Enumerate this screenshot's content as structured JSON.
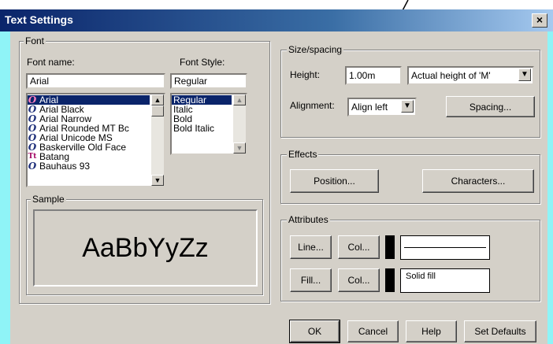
{
  "window": {
    "title": "Text Settings",
    "close_glyph": "×"
  },
  "font": {
    "legend": "Font",
    "name_label": "Font name:",
    "style_label": "Font Style:",
    "name_value": "Arial",
    "style_value": "Regular",
    "fonts": [
      {
        "label": "Arial",
        "icon": "O",
        "selected": true
      },
      {
        "label": "Arial Black",
        "icon": "O"
      },
      {
        "label": "Arial Narrow",
        "icon": "O"
      },
      {
        "label": "Arial Rounded MT Bc",
        "icon": "O"
      },
      {
        "label": "Arial Unicode MS",
        "icon": "O"
      },
      {
        "label": "Baskerville Old Face",
        "icon": "O"
      },
      {
        "label": "Batang",
        "icon": "Tt"
      },
      {
        "label": "Bauhaus 93",
        "icon": "O"
      }
    ],
    "styles": [
      {
        "label": "Regular",
        "selected": true
      },
      {
        "label": "Italic"
      },
      {
        "label": "Bold"
      },
      {
        "label": "Bold Italic"
      }
    ]
  },
  "sample": {
    "legend": "Sample",
    "text": "AaBbYyZz"
  },
  "size": {
    "legend": "Size/spacing",
    "height_label": "Height:",
    "height_value": "1.00m",
    "height_mode": "Actual height of 'M'",
    "alignment_label": "Alignment:",
    "alignment_value": "Align left",
    "spacing_button": "Spacing..."
  },
  "effects": {
    "legend": "Effects",
    "position_button": "Position...",
    "characters_button": "Characters..."
  },
  "attributes": {
    "legend": "Attributes",
    "line_button": "Line...",
    "line_col_button": "Col...",
    "fill_button": "Fill...",
    "fill_col_button": "Col...",
    "fill_value": "Solid fill",
    "line_color": "#000000",
    "fill_color": "#000000"
  },
  "buttons": {
    "ok": "OK",
    "cancel": "Cancel",
    "help": "Help",
    "set_defaults": "Set Defaults"
  },
  "colors": {
    "face": "#d4d0c8",
    "selection": "#0a246a",
    "title_dark": "#0a246a",
    "title_light": "#a6caf0",
    "frame": "#8ff4f7"
  }
}
